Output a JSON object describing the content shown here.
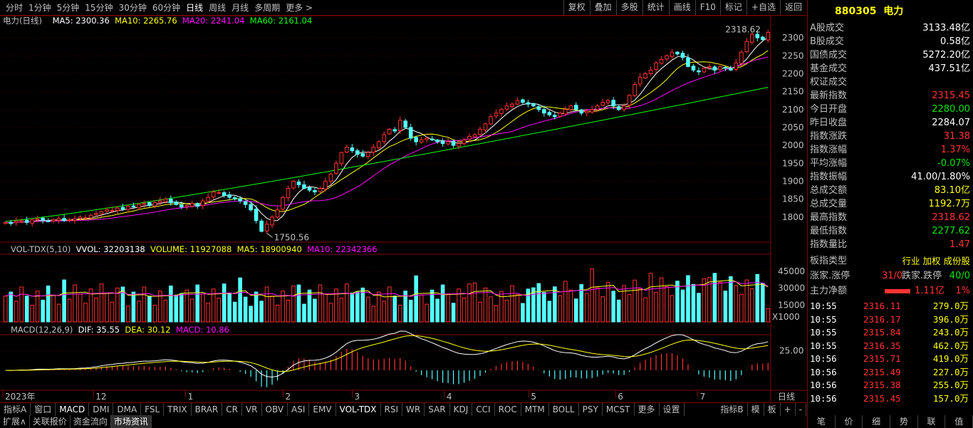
{
  "toolbar": {
    "periods": [
      "分时",
      "1分钟",
      "5分钟",
      "15分钟",
      "30分钟",
      "60分钟",
      "日线",
      "周线",
      "月线",
      "多周期",
      "更多 >"
    ],
    "active_period": "日线",
    "tools": [
      "复权",
      "叠加",
      "多股",
      "统计",
      "画线",
      "F10",
      "标记",
      "+自选",
      "返回"
    ]
  },
  "main_info": {
    "name": "电力(日线)",
    "ma5": "MA5: 2300.36",
    "ma10": "MA10: 2265.76",
    "ma20": "MA20: 2241.04",
    "ma60": "MA60: 2161.04",
    "colors": {
      "ma5": "#ffffff",
      "ma10": "#ffff00",
      "ma20": "#ff00ff",
      "ma60": "#00ff00"
    }
  },
  "vol_info": {
    "name": "VOL-TDX(5,10)",
    "vvol": "VVOL: 32203138",
    "volume": "VOLUME: 11927088",
    "ma5": "MA5: 18900940",
    "ma10": "MA10: 22342366"
  },
  "macd_info": {
    "name": "MACD(12,26,9)",
    "dif": "DIF: 35.55",
    "dea": "DEA: 30.12",
    "macd": "MACD: 10.86"
  },
  "annotations": {
    "high": "2318.62",
    "low": "1750.56",
    "vol_unit": "X1000",
    "axis_unit": "日线"
  },
  "chart_data": {
    "type": "candlestick",
    "price_axis": {
      "ticks": [
        1800,
        1850,
        1900,
        1950,
        2000,
        2050,
        2100,
        2150,
        2200,
        2250,
        2300
      ],
      "range": [
        1730,
        2330
      ]
    },
    "volume_axis": {
      "ticks": [
        15000,
        30000,
        45000
      ]
    },
    "macd_axis": {
      "ticks": [
        25.0
      ]
    },
    "time_labels": [
      "2023年",
      "12",
      "1",
      "2",
      "3",
      "4",
      "5",
      "6",
      "7"
    ],
    "close_series": [
      1785,
      1782,
      1788,
      1790,
      1785,
      1792,
      1795,
      1790,
      1788,
      1793,
      1796,
      1790,
      1792,
      1795,
      1800,
      1798,
      1805,
      1810,
      1815,
      1820,
      1818,
      1825,
      1822,
      1830,
      1828,
      1835,
      1838,
      1832,
      1840,
      1845,
      1850,
      1840,
      1835,
      1828,
      1832,
      1838,
      1830,
      1845,
      1855,
      1870,
      1868,
      1860,
      1855,
      1850,
      1845,
      1835,
      1820,
      1790,
      1760,
      1780,
      1800,
      1820,
      1855,
      1880,
      1900,
      1890,
      1880,
      1875,
      1870,
      1880,
      1900,
      1920,
      1950,
      1980,
      1995,
      1985,
      1975,
      1970,
      1980,
      1995,
      2010,
      2030,
      2045,
      2040,
      2070,
      2050,
      2020,
      2010,
      2015,
      2020,
      2015,
      2010,
      2005,
      2010,
      2000,
      2005,
      2015,
      2025,
      2030,
      2045,
      2060,
      2080,
      2090,
      2100,
      2110,
      2115,
      2125,
      2120,
      2115,
      2110,
      2100,
      2090,
      2085,
      2080,
      2090,
      2100,
      2110,
      2100,
      2090,
      2095,
      2100,
      2110,
      2120,
      2125,
      2110,
      2100,
      2110,
      2140,
      2170,
      2190,
      2200,
      2210,
      2230,
      2240,
      2250,
      2260,
      2255,
      2245,
      2220,
      2210,
      2205,
      2215,
      2220,
      2210,
      2220,
      2215,
      2210,
      2230,
      2260,
      2290,
      2310,
      2300,
      2295,
      2315
    ],
    "ma60_start": 1788,
    "ma60_end": 2162,
    "volume_last": 11927,
    "macd_last": {
      "dif": 35.55,
      "dea": 30.12,
      "macd": 10.86
    }
  },
  "right_panel": {
    "code": "880305",
    "name": "电力",
    "rows": [
      {
        "label": "A股成交",
        "value": "3133.48亿",
        "color": "#ffffff"
      },
      {
        "label": "B股成交",
        "value": "0.58亿",
        "color": "#ffffff"
      },
      {
        "label": "国债成交",
        "value": "5272.20亿",
        "color": "#ffffff"
      },
      {
        "label": "基金成交",
        "value": "437.51亿",
        "color": "#ffffff"
      },
      {
        "label": "权证成交",
        "value": "",
        "color": "#ffffff"
      },
      {
        "label": "最新指数",
        "value": "2315.45",
        "color": "#ff3232"
      },
      {
        "label": "今日开盘",
        "value": "2280.00",
        "color": "#00e600"
      },
      {
        "label": "昨日收盘",
        "value": "2284.07",
        "color": "#ffffff"
      },
      {
        "label": "指数涨跌",
        "value": "31.38",
        "color": "#ff3232"
      },
      {
        "label": "指数涨幅",
        "value": "1.37%",
        "color": "#ff3232"
      },
      {
        "label": "平均涨幅",
        "value": "-0.07%",
        "color": "#00e600"
      },
      {
        "label": "指数振幅",
        "value": "41.00/1.80%",
        "color": "#ffffff"
      },
      {
        "label": "总成交额",
        "value": "83.10亿",
        "color": "#ffff00"
      },
      {
        "label": "总成交量",
        "value": "1192.7万",
        "color": "#ffff00"
      },
      {
        "label": "最高指数",
        "value": "2318.62",
        "color": "#ff3232"
      },
      {
        "label": "最低指数",
        "value": "2277.62",
        "color": "#00e600"
      },
      {
        "label": "指数量比",
        "value": "1.47",
        "color": "#ff3232"
      }
    ],
    "type_label": "板指类型",
    "type_value": "行业 加权 成份股",
    "up_label": "涨家.涨停",
    "up_value": "31/0",
    "down_label": "跌家.跌停",
    "down_value": "40/0",
    "main_label": "主力净额",
    "main_value": "1.11亿",
    "main_pct": "1%",
    "ticks": [
      {
        "time": "10:55",
        "price": "2316.11",
        "vol": "279.0万"
      },
      {
        "time": "10:55",
        "price": "2316.17",
        "vol": "396.0万"
      },
      {
        "time": "10:55",
        "price": "2315.84",
        "vol": "243.0万"
      },
      {
        "time": "10:55",
        "price": "2316.35",
        "vol": "462.0万"
      },
      {
        "time": "10:56",
        "price": "2315.71",
        "vol": "419.0万"
      },
      {
        "time": "10:56",
        "price": "2315.49",
        "vol": "227.0万"
      },
      {
        "time": "10:56",
        "price": "2315.38",
        "vol": "255.0万"
      },
      {
        "time": "10:56",
        "price": "2315.45",
        "vol": "157.0万"
      }
    ],
    "bottom_tabs": [
      "笔",
      "价",
      "细",
      "势",
      "联",
      "值"
    ]
  },
  "indicator_tabs": [
    "指标A",
    "窗口",
    "MACD",
    "DMI",
    "DMA",
    "FSL",
    "TRIX",
    "BRAR",
    "CR",
    "VR",
    "OBV",
    "ASI",
    "EMV",
    "VOL-TDX",
    "RSI",
    "WR",
    "SAR",
    "KDJ",
    "CCI",
    "ROC",
    "MTM",
    "BOLL",
    "PSY",
    "MCST",
    "更多",
    "设置"
  ],
  "indicator_tabs_right": [
    "指标B",
    "模",
    "板",
    "+",
    "-"
  ],
  "bottom_tabs": [
    "扩展∧",
    "关联报价",
    "资金流向",
    "市场资讯"
  ],
  "active_bottom_tab": "市场资讯"
}
